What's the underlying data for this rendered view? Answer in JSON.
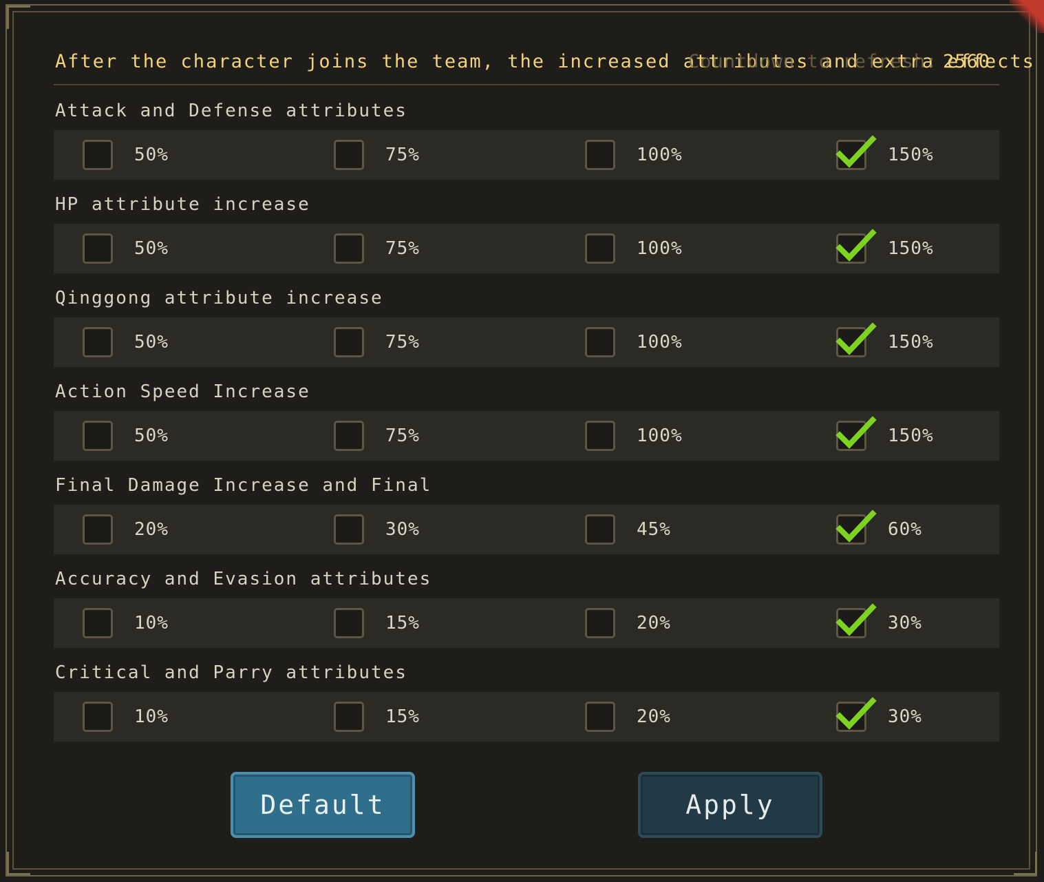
{
  "header": {
    "text": "After the character joins the team, the increased attributes and extra effects will",
    "ghost_text": "Countdown to refresh:",
    "number": "2560"
  },
  "sections": [
    {
      "title": "Attack and Defense attributes",
      "options": [
        "50%",
        "75%",
        "100%",
        "150%"
      ],
      "selected": 3
    },
    {
      "title": "HP attribute increase",
      "options": [
        "50%",
        "75%",
        "100%",
        "150%"
      ],
      "selected": 3
    },
    {
      "title": "Qinggong attribute increase",
      "options": [
        "50%",
        "75%",
        "100%",
        "150%"
      ],
      "selected": 3
    },
    {
      "title": "Action Speed Increase",
      "options": [
        "50%",
        "75%",
        "100%",
        "150%"
      ],
      "selected": 3
    },
    {
      "title": "Final Damage Increase and Final",
      "options": [
        "20%",
        "30%",
        "45%",
        "60%"
      ],
      "selected": 3
    },
    {
      "title": "Accuracy and Evasion attributes",
      "options": [
        "10%",
        "15%",
        "20%",
        "30%"
      ],
      "selected": 3
    },
    {
      "title": "Critical and Parry attributes",
      "options": [
        "10%",
        "15%",
        "20%",
        "30%"
      ],
      "selected": 3
    }
  ],
  "buttons": {
    "default": "Default",
    "apply": "Apply"
  },
  "colors": {
    "check": "#7ed321",
    "header_text": "#f2d27a",
    "default_button": "#2f6f8c",
    "apply_button": "#213a45"
  }
}
